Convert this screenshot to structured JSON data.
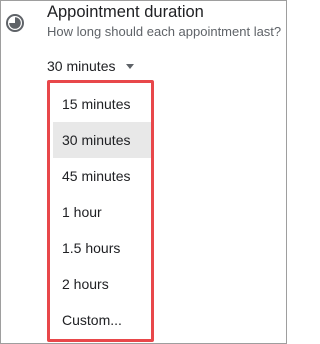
{
  "section": {
    "title": "Appointment duration",
    "subtitle": "How long should each appointment last?",
    "icon": "clock-icon"
  },
  "select": {
    "value": "30 minutes",
    "caret_icon": "caret-down-icon"
  },
  "menu": {
    "items": [
      {
        "label": "15 minutes"
      },
      {
        "label": "30 minutes",
        "selected": true
      },
      {
        "label": "45 minutes"
      },
      {
        "label": "1 hour"
      },
      {
        "label": "1.5 hours"
      },
      {
        "label": "2 hours"
      },
      {
        "label": "Custom..."
      }
    ]
  },
  "colors": {
    "highlight_border": "#e8474a",
    "selected_bg": "#e8e8e8",
    "text": "#202124",
    "secondary_text": "#5f6368"
  }
}
